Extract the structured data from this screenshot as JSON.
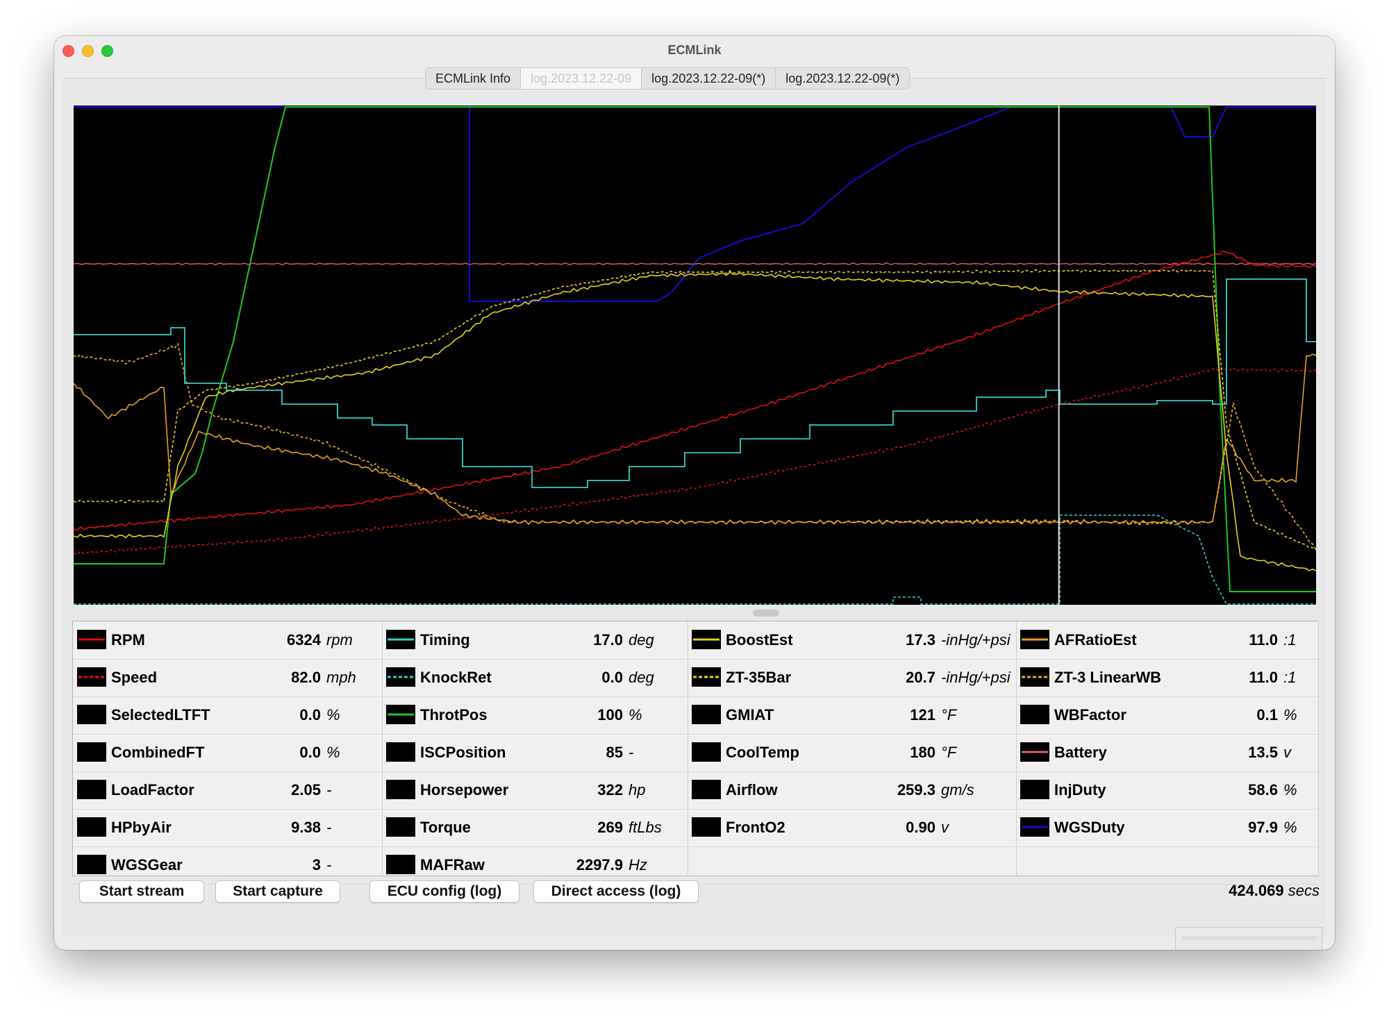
{
  "window": {
    "title": "ECMLink"
  },
  "tabs": [
    {
      "label": "ECMLink Info",
      "active": false
    },
    {
      "label": "log.2023.12.22-09",
      "active": true
    },
    {
      "label": "log.2023.12.22-09(*)",
      "active": false
    },
    {
      "label": "log.2023.12.22-09(*)",
      "active": false
    }
  ],
  "graph": {
    "cursor_fraction": 0.793,
    "series_colors": {
      "RPM": "#e01010",
      "Speed": "#d01010",
      "Timing": "#30d0d0",
      "KnockRet": "#30d0d0",
      "ThrotPos": "#20c820",
      "BoostEst": "#e8d020",
      "ZT-35Bar": "#e8d020",
      "AFRatioEst": "#e8a020",
      "ZT-3 LinearWB": "#e8b020",
      "Battery": "#e06060",
      "WGSDuty": "#1010d0"
    }
  },
  "params": {
    "col1": [
      {
        "name": "RPM",
        "value": "6324",
        "unit": "rpm",
        "color": "#e01010",
        "style": "solid"
      },
      {
        "name": "Speed",
        "value": "82.0",
        "unit": "mph",
        "color": "#e01010",
        "style": "dashed"
      },
      {
        "name": "SelectedLTFT",
        "value": "0.0",
        "unit": "%",
        "color": "",
        "style": "none"
      },
      {
        "name": "CombinedFT",
        "value": "0.0",
        "unit": "%",
        "color": "",
        "style": "none"
      },
      {
        "name": "LoadFactor",
        "value": "2.05",
        "unit": "-",
        "color": "",
        "style": "none"
      },
      {
        "name": "HPbyAir",
        "value": "9.38",
        "unit": "-",
        "color": "",
        "style": "none"
      },
      {
        "name": "WGSGear",
        "value": "3",
        "unit": "-",
        "color": "",
        "style": "none"
      }
    ],
    "col2": [
      {
        "name": "Timing",
        "value": "17.0",
        "unit": "deg",
        "color": "#30d0d0",
        "style": "solid"
      },
      {
        "name": "KnockRet",
        "value": "0.0",
        "unit": "deg",
        "color": "#30d0d0",
        "style": "dashed"
      },
      {
        "name": "ThrotPos",
        "value": "100",
        "unit": "%",
        "color": "#20c820",
        "style": "solid"
      },
      {
        "name": "ISCPosition",
        "value": "85",
        "unit": "-",
        "color": "",
        "style": "none"
      },
      {
        "name": "Horsepower",
        "value": "322",
        "unit": "hp",
        "color": "",
        "style": "none"
      },
      {
        "name": "Torque",
        "value": "269",
        "unit": "ftLbs",
        "color": "",
        "style": "none"
      },
      {
        "name": "MAFRaw",
        "value": "2297.9",
        "unit": "Hz",
        "color": "",
        "style": "none"
      }
    ],
    "col3": [
      {
        "name": "BoostEst",
        "value": "17.3",
        "unit": "-inHg/+psi",
        "color": "#e8d020",
        "style": "solid"
      },
      {
        "name": "ZT-35Bar",
        "value": "20.7",
        "unit": "-inHg/+psi",
        "color": "#e8d020",
        "style": "dashed"
      },
      {
        "name": "GMIAT",
        "value": "121",
        "unit": "°F",
        "color": "",
        "style": "none"
      },
      {
        "name": "CoolTemp",
        "value": "180",
        "unit": "°F",
        "color": "",
        "style": "none"
      },
      {
        "name": "Airflow",
        "value": "259.3",
        "unit": "gm/s",
        "color": "",
        "style": "none"
      },
      {
        "name": "FrontO2",
        "value": "0.90",
        "unit": "v",
        "color": "",
        "style": "none"
      }
    ],
    "col4": [
      {
        "name": "AFRatioEst",
        "value": "11.0",
        "unit": ":1",
        "color": "#e8a020",
        "style": "solid"
      },
      {
        "name": "ZT-3 LinearWB",
        "value": "11.0",
        "unit": ":1",
        "color": "#e8b020",
        "style": "dashed"
      },
      {
        "name": "WBFactor",
        "value": "0.1",
        "unit": "%",
        "color": "",
        "style": "none"
      },
      {
        "name": "Battery",
        "value": "13.5",
        "unit": "v",
        "color": "#e06060",
        "style": "solid"
      },
      {
        "name": "InjDuty",
        "value": "58.6",
        "unit": "%",
        "color": "",
        "style": "none"
      },
      {
        "name": "WGSDuty",
        "value": "97.9",
        "unit": "%",
        "color": "#1010d0",
        "style": "solid"
      }
    ]
  },
  "buttons": {
    "start_stream": "Start stream",
    "start_capture": "Start capture",
    "ecu_config": "ECU config (log)",
    "direct_access": "Direct access (log)"
  },
  "status": {
    "elapsed_value": "424.069",
    "elapsed_unit": "secs"
  }
}
